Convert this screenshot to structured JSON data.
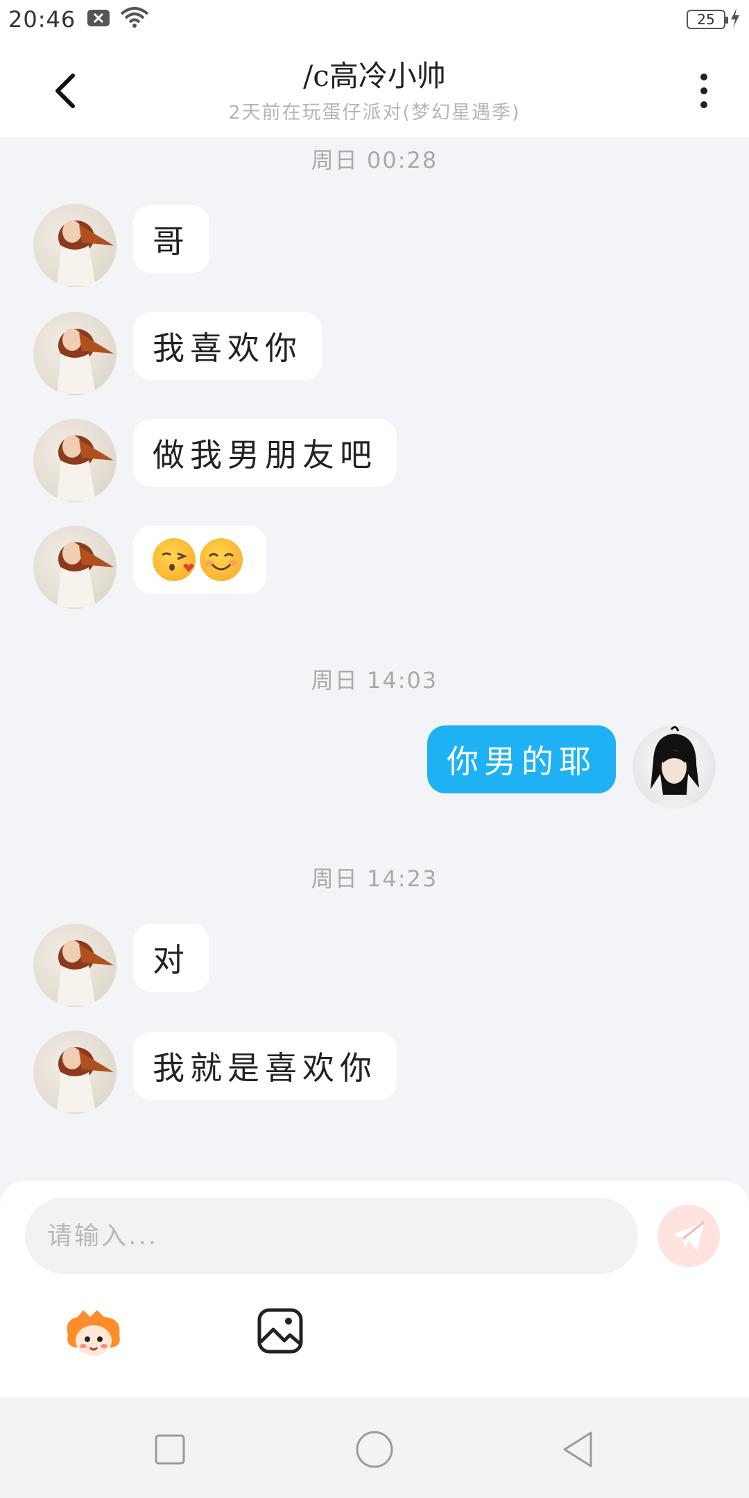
{
  "status_bar": {
    "time": "20:46",
    "battery": "25"
  },
  "header": {
    "title": "/c高冷小帅",
    "subtitle": "2天前在玩蛋仔派对(梦幻星遇季)"
  },
  "messages": {
    "time_1": "周日 00:28",
    "msg_1": "哥",
    "msg_2": "我喜欢你",
    "msg_3": "做我男朋友吧",
    "msg_4_emojis": [
      "kissing-face-emoji",
      "smiling-face-emoji"
    ],
    "time_2": "周日 14:03",
    "msg_me_1": "你男的耶",
    "time_3": "周日 14:23",
    "msg_5": "对",
    "msg_6": "我就是喜欢你"
  },
  "input": {
    "placeholder": "请输入..."
  },
  "colors": {
    "my_bubble": "#1eb2f5",
    "send_button_bg": "#ffe3e0",
    "send_icon": "#ff8a80"
  }
}
